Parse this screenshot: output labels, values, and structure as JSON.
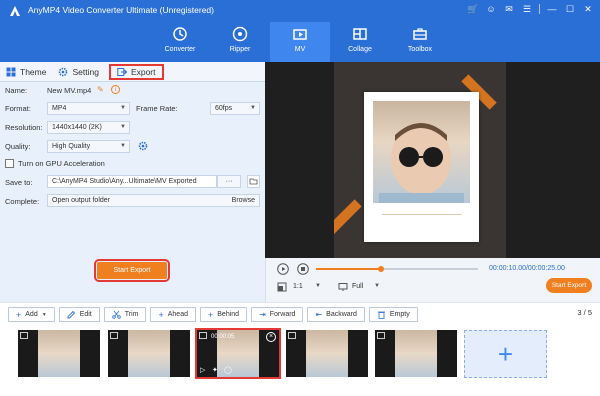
{
  "app": {
    "title": "AnyMP4 Video Converter Ultimate (Unregistered)"
  },
  "nav": [
    {
      "label": "Converter",
      "icon": "converter-icon"
    },
    {
      "label": "Ripper",
      "icon": "ripper-icon"
    },
    {
      "label": "MV",
      "icon": "mv-icon",
      "active": true
    },
    {
      "label": "Collage",
      "icon": "collage-icon"
    },
    {
      "label": "Toolbox",
      "icon": "toolbox-icon"
    }
  ],
  "tabs": {
    "theme": "Theme",
    "setting": "Setting",
    "export": "Export"
  },
  "form": {
    "name_label": "Name:",
    "name_value": "New MV.mp4",
    "format_label": "Format:",
    "format_value": "MP4",
    "frame_rate_label": "Frame Rate:",
    "frame_rate_value": "60fps",
    "resolution_label": "Resolution:",
    "resolution_value": "1440x1440 (2K)",
    "quality_label": "Quality:",
    "quality_value": "High Quality",
    "gpu_label": "Turn on GPU Acceleration",
    "save_to_label": "Save to:",
    "save_to_value": "C:\\AnyMP4 Studio\\Any...Ultimate\\MV Exported",
    "save_to_more": "···",
    "complete_label": "Complete:",
    "complete_value": "Open output folder",
    "browse_label": "Browse"
  },
  "start_export": "Start Export",
  "player": {
    "time": "00:00:10.00/00:00:25.00",
    "ratio": "1:1",
    "mode": "Full",
    "start_export": "Start Export",
    "progress": 0.4
  },
  "toolbar": {
    "add": "Add",
    "edit": "Edit",
    "trim": "Trim",
    "ahead": "Ahead",
    "behind": "Behind",
    "forward": "Forward",
    "backward": "Backward",
    "empty": "Empty",
    "page": "3 / 5"
  },
  "clips": [
    {
      "active": false
    },
    {
      "active": false
    },
    {
      "active": true,
      "time": "00:00:05"
    },
    {
      "active": false
    },
    {
      "active": false
    }
  ],
  "colors": {
    "accent": "#2a6fd6",
    "orange": "#f07f1f",
    "highlight": "#e53935"
  }
}
